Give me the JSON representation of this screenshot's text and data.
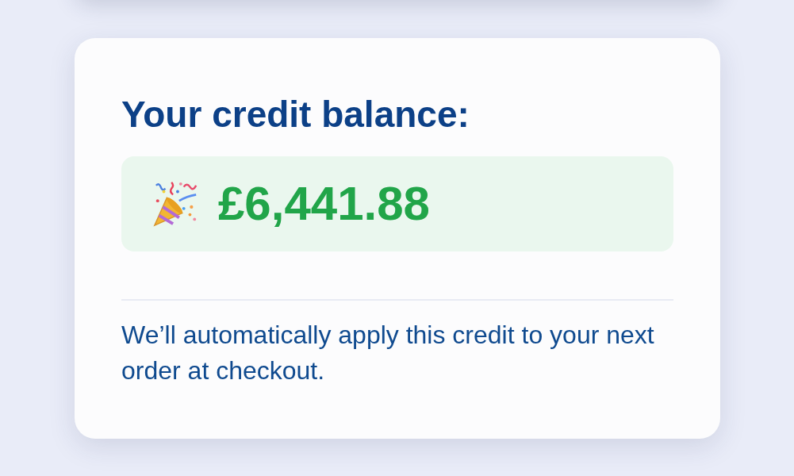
{
  "credit_card": {
    "title": "Your credit balance:",
    "amount": "£6,441.88",
    "note": "We’ll automatically apply this credit to your next order at checkout."
  }
}
